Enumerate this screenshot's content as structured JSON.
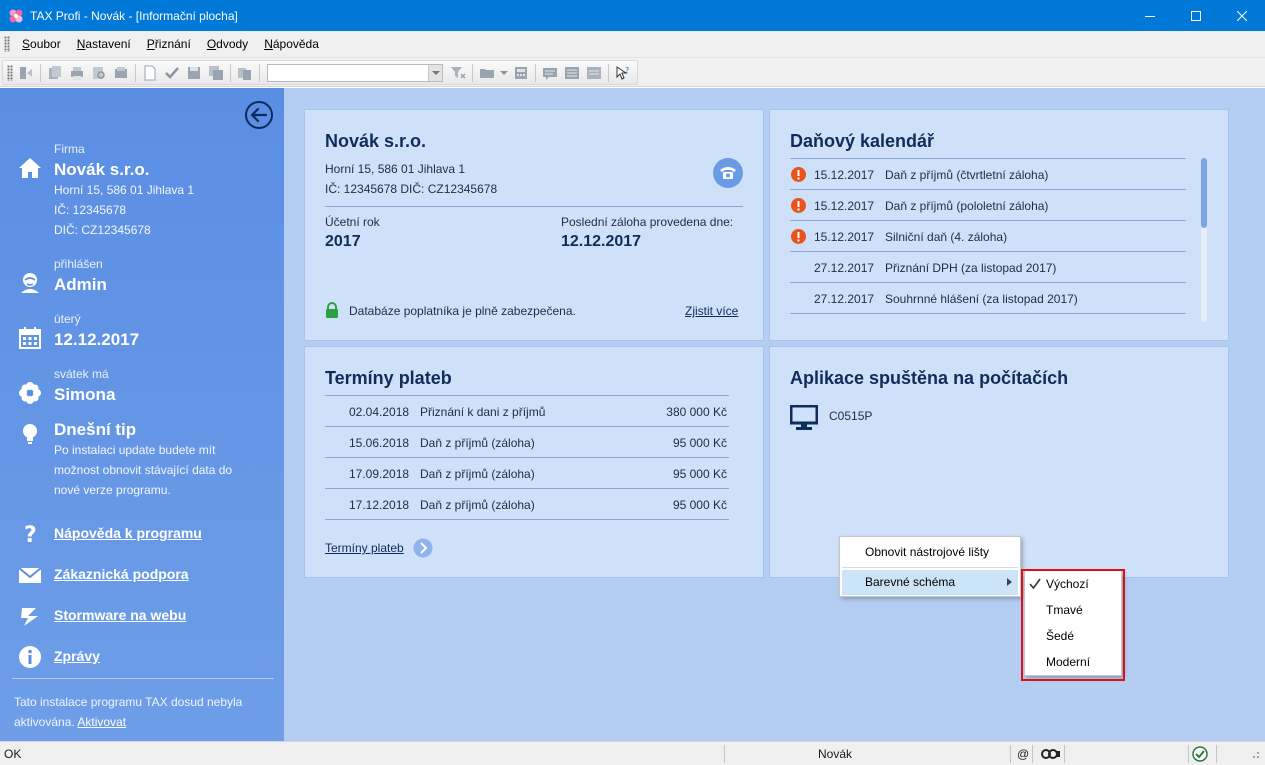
{
  "window": {
    "title": "TAX Profi - Novák - [Informační plocha]"
  },
  "menu": {
    "items": [
      {
        "first": "S",
        "rest": "oubor"
      },
      {
        "first": "N",
        "rest": "astavení"
      },
      {
        "first": "P",
        "rest": "řiznání"
      },
      {
        "first": "O",
        "rest": "dvody"
      },
      {
        "first": "N",
        "rest": "ápověda"
      }
    ]
  },
  "sidebar": {
    "firma_label": "Firma",
    "firma_name": "Novák s.r.o.",
    "firma_address": "Horní 15, 586 01 Jihlava 1",
    "firma_ic": "IČ: 12345678",
    "firma_dic": "DIČ: CZ12345678",
    "login_label": "přihlášen",
    "login_user": "Admin",
    "day_label": "úterý",
    "date": "12.12.2017",
    "nameday_label": "svátek má",
    "nameday_name": "Simona",
    "tip_title": "Dnešní tip",
    "tip_lines": [
      "Po instalaci update budete mít",
      "možnost obnovit stávající data do",
      "nové verze programu."
    ],
    "links": [
      "Nápověda k programu",
      "Zákaznická podpora",
      "Stormware na webu",
      "Zprávy"
    ],
    "footer_text_1": "Tato instalace programu TAX dosud nebyla",
    "footer_text_2": "aktivována.",
    "footer_link": "Aktivovat"
  },
  "company_card": {
    "title": "Novák s.r.o.",
    "address": "Horní 15, 586 01 Jihlava 1",
    "ids": "IČ: 12345678  DIČ: CZ12345678",
    "year_label": "Účetní rok",
    "year_value": "2017",
    "advance_label": "Poslední záloha provedena dne:",
    "advance_value": "12.12.2017",
    "security_text": "Databáze poplatníka je plně zabezpečena.",
    "more_link": "Zjistit více"
  },
  "tax_calendar": {
    "title": "Daňový kalendář",
    "rows": [
      {
        "date": "15.12.2017",
        "text": "Daň z příjmů (čtvrtletní záloha)",
        "warn": true
      },
      {
        "date": "15.12.2017",
        "text": "Daň z příjmů (pololetní záloha)",
        "warn": true
      },
      {
        "date": "15.12.2017",
        "text": "Silniční daň (4. záloha)",
        "warn": true
      },
      {
        "date": "27.12.2017",
        "text": "Přiznání DPH (za listopad 2017)",
        "warn": false
      },
      {
        "date": "27.12.2017",
        "text": "Souhrnné hlášení (za listopad 2017)",
        "warn": false
      }
    ]
  },
  "payments": {
    "title": "Termíny plateb",
    "rows": [
      {
        "date": "02.04.2018",
        "text": "Přiznání k dani z příjmů",
        "amount": "380 000 Kč"
      },
      {
        "date": "15.06.2018",
        "text": "Daň z příjmů (záloha)",
        "amount": "95 000 Kč"
      },
      {
        "date": "17.09.2018",
        "text": "Daň z příjmů (záloha)",
        "amount": "95 000 Kč"
      },
      {
        "date": "17.12.2018",
        "text": "Daň z příjmů (záloha)",
        "amount": "95 000 Kč"
      }
    ],
    "link": "Termíny plateb"
  },
  "computers": {
    "title": "Aplikace spuštěna na počítačích",
    "items": [
      "C0515P"
    ]
  },
  "context_menu": {
    "item1": "Obnovit nástrojové lišty",
    "item2": "Barevné schéma",
    "submenu": [
      "Výchozí",
      "Tmavé",
      "Šedé",
      "Moderní"
    ]
  },
  "statusbar": {
    "left": "OK",
    "center": "Novák",
    "at": "@"
  },
  "colors": {
    "title_bar": "#0078d7",
    "sidebar": "#5a8ee3",
    "main_bg": "#b4cdf3",
    "card_bg": "#cfe0f9",
    "warn": "#e8541c",
    "highlight_border": "#e01010"
  }
}
